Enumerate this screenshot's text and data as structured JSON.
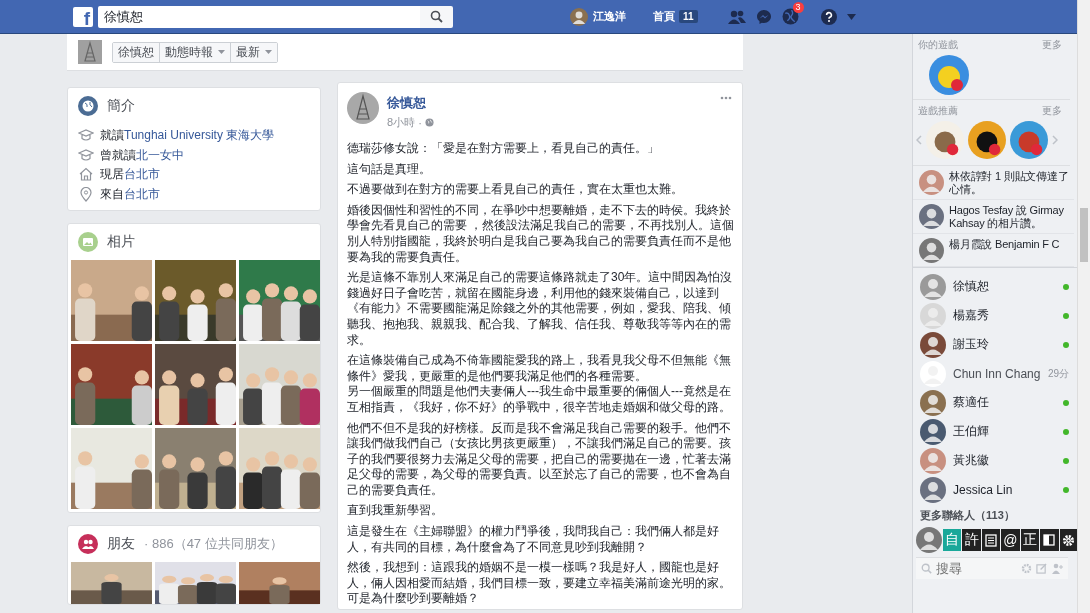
{
  "top_bar": {
    "logo": "f",
    "search_value": "徐慎恕",
    "user": "江逸洋",
    "home": "首頁",
    "home_count": "11",
    "notifications_count": "3"
  },
  "profile_header": {
    "buttons": [
      {
        "label": "徐慎恕",
        "dropdown": false
      },
      {
        "label": "動態時報",
        "dropdown": true
      },
      {
        "label": "最新",
        "dropdown": true
      }
    ]
  },
  "intro": {
    "title": "簡介",
    "items": [
      {
        "kind": "education",
        "prefix": "就讀",
        "link": "Tunghai University 東海大學"
      },
      {
        "kind": "education",
        "prefix": "曾就讀",
        "link": "北一女中"
      },
      {
        "kind": "home",
        "prefix": "現居",
        "link": "台北市"
      },
      {
        "kind": "place",
        "prefix": "來自",
        "link": "台北市"
      }
    ]
  },
  "photos": {
    "title": "相片"
  },
  "friends": {
    "title": "朋友",
    "summary": "· 886（47 位共同朋友）"
  },
  "post": {
    "author": "徐慎恕",
    "time": "8小時",
    "time_separator": "·",
    "paragraphs": [
      "德瑞莎修女說：「愛是在對方需要上，看見自己的責任。」",
      "這句話是真理。",
      "不過要做到在對方的需要上看見自己的責任，實在太重也太難。",
      "婚後因個性和習性的不同，在爭吵中想要離婚，走不下去的時侯。我終於學會先看見自己的需要 ，然後設法滿足我自己的需要，不再找別人。這個別人特別指國龍，我終於明白是我自己要為我自己的需要負責任而不是他要為我的需要負責任。",
      "光是這條不靠別人來滿足自己的需要這條路就走了30年。這中間因為怕沒錢過好日子會吃苦，就留在國龍身邊，利用他的錢來裝備自己，以達到《有能力》不需要國龍滿足除錢之外的其他需要，例如，愛我、陪我、傾聽我、抱抱我、親親我、配合我、了解我、信任我、尊敬我等等內在的需求。",
      [
        "在這條裝備自己成為不倚靠國龍愛我的路上，我看見我父母不但無能《無條件》愛我，更嚴重的是他們要我滿足他們的各種需要。",
        "另一個嚴重的問題是他們夫妻倆人---我生命中最重要的倆個人---竟然是在互相指責，《我好，你不好》的爭戰中，很辛苦地走婚姻和做父母的路。"
      ],
      "他們不但不是我的好榜樣。反而是我不會滿足我自己需要的殺手。他們不讓我們做我們自己（女孩比男孩更嚴重），不讓我們滿足自己的需要。孩子的我們要很努力去滿足父母的需要，把自己的需要拋在一邊，忙著去滿足父母的需要，為父母的需要負責。以至於忘了自己的需要，也不會為自己的需要負責任。",
      "直到我重新學習。",
      "這是發生在《主婦聯盟》的權力鬥爭後，我問我自己：我們倆人都是好人，有共同的目標，為什麼會為了不同意見吵到我離開？",
      "然後，我想到：這跟我的婚姻不是一模一樣嗎？我是好人，國龍也是好人，倆人因相愛而結婚，我們目標一致，要建立幸福美滿前途光明的家。可是為什麼吵到要離婚？"
    ]
  },
  "sidebar": {
    "games_title": "你的遊戲",
    "games_more": "更多",
    "featured_title": "遊戲推薦",
    "featured_more": "更多",
    "ticker": [
      "林依諄對 1 則貼文傳達了心情。",
      "Hagos Tesfay 說 Girmay Kahsay 的相片讚。",
      "楊月霞說 Benjamin F C"
    ],
    "contacts": [
      {
        "name": "徐慎恕",
        "online": true
      },
      {
        "name": "楊嘉秀",
        "online": true
      },
      {
        "name": "謝玉玲",
        "online": true
      },
      {
        "name": "Chun Inn Chang",
        "online": false,
        "last_seen": "29分"
      },
      {
        "name": "蔡適任",
        "online": true
      },
      {
        "name": "王伯輝",
        "online": true
      },
      {
        "name": "黃兆徽",
        "online": true
      },
      {
        "name": "Jessica Lin",
        "online": true
      }
    ],
    "more_contacts": "更多聯絡人（113）",
    "ime_keys": [
      {
        "kind": "text",
        "label": "自",
        "selected": true
      },
      {
        "kind": "text",
        "label": "許",
        "selected": false
      },
      {
        "kind": "doc",
        "selected": false
      },
      {
        "kind": "text",
        "label": "@",
        "selected": false
      },
      {
        "kind": "text",
        "label": "正",
        "selected": false
      },
      {
        "kind": "contrast",
        "selected": false
      },
      {
        "kind": "settings",
        "selected": false
      }
    ],
    "search_placeholder": "搜尋"
  }
}
